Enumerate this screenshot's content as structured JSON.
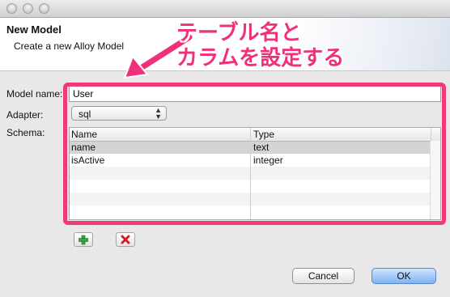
{
  "header": {
    "title": "New Model",
    "subtitle": "Create a new Alloy Model"
  },
  "form": {
    "model_name_label": "Model name:",
    "model_name_value": "User",
    "adapter_label": "Adapter:",
    "adapter_value": "sql",
    "schema_label": "Schema:"
  },
  "schema_table": {
    "columns": [
      "Name",
      "Type"
    ],
    "rows": [
      {
        "name": "name",
        "type": "text",
        "selected": true
      },
      {
        "name": "isActive",
        "type": "integer",
        "selected": false
      }
    ]
  },
  "annotation": {
    "line1": "テーブル名と",
    "line2": "カラムを設定する",
    "color": "#f0307a"
  },
  "toolbar": {
    "add_icon": "plus-icon",
    "remove_icon": "delete-x-icon"
  },
  "buttons": {
    "cancel": "Cancel",
    "ok": "OK"
  }
}
